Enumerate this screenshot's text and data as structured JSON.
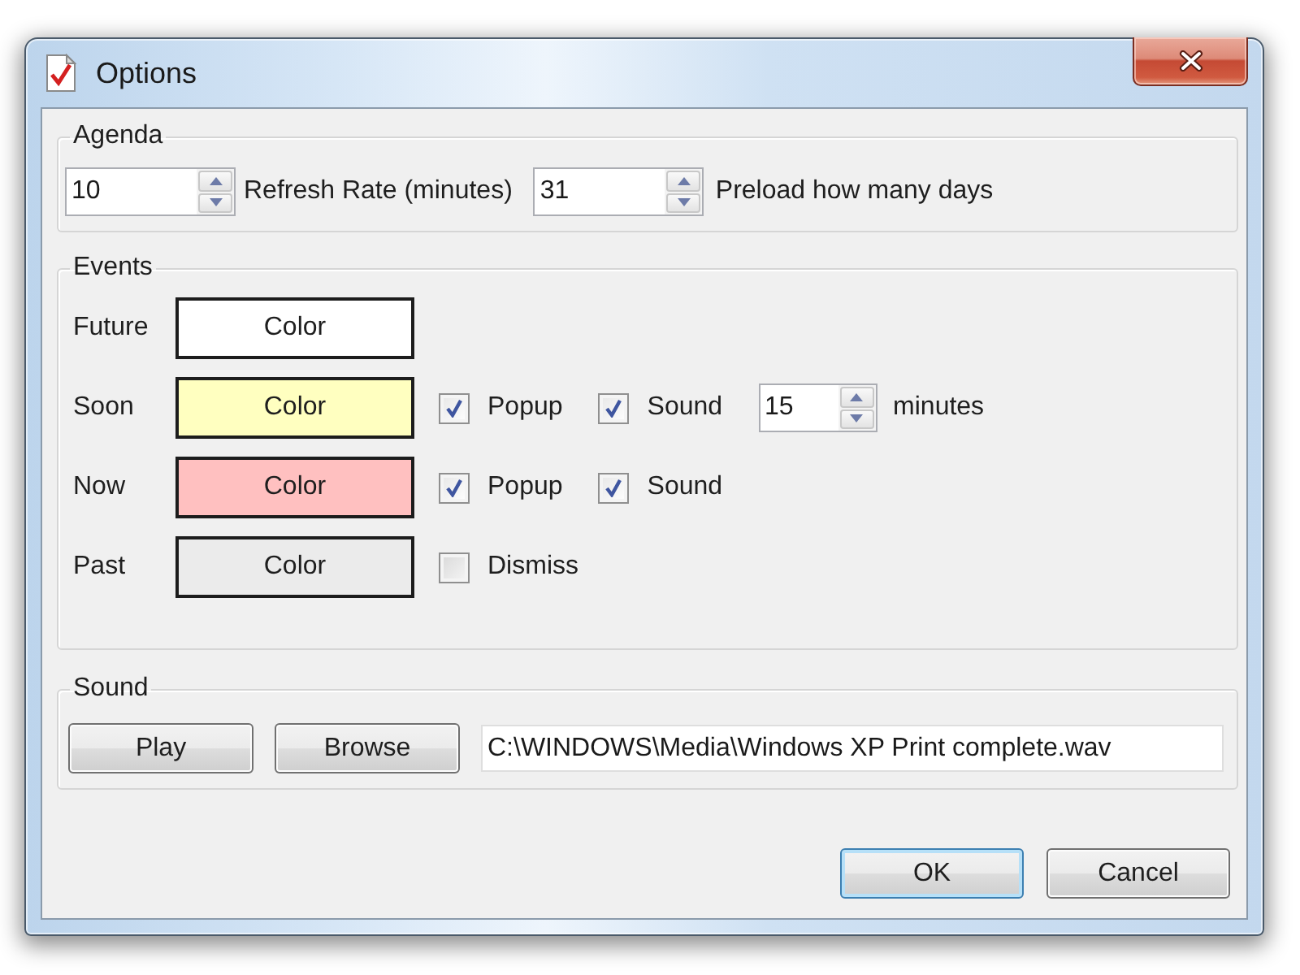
{
  "window": {
    "title": "Options"
  },
  "agenda": {
    "title": "Agenda",
    "spinners": [
      {
        "value": "10",
        "caption": "Refresh Rate (minutes)"
      },
      {
        "value": "31",
        "caption": "Preload how many days"
      }
    ]
  },
  "events": {
    "title": "Events",
    "rows": [
      {
        "label": "Future",
        "button": "Color",
        "color": "#ffffff"
      },
      {
        "label": "Soon",
        "button": "Color",
        "color": "#ffffc0",
        "options": [
          {
            "kind": "checkbox",
            "label": "Popup",
            "checked": true
          },
          {
            "kind": "checkbox",
            "label": "Sound",
            "checked": true
          },
          {
            "kind": "spinner",
            "value": "15",
            "caption": "minutes"
          }
        ]
      },
      {
        "label": "Now",
        "button": "Color",
        "color": "#ffc0c0",
        "options": [
          {
            "kind": "checkbox",
            "label": "Popup",
            "checked": true
          },
          {
            "kind": "checkbox",
            "label": "Sound",
            "checked": true
          }
        ]
      },
      {
        "label": "Past",
        "button": "Color",
        "color": "#ebebeb",
        "options": [
          {
            "kind": "checkbox",
            "label": "Dismiss",
            "checked": false
          }
        ]
      }
    ]
  },
  "sound": {
    "title": "Sound",
    "buttons": [
      "Play",
      "Browse"
    ],
    "file_path": "C:\\WINDOWS\\Media\\Windows XP Print complete.wav"
  },
  "buttons": [
    {
      "label": "OK",
      "default": true
    },
    {
      "label": "Cancel",
      "default": false
    }
  ]
}
